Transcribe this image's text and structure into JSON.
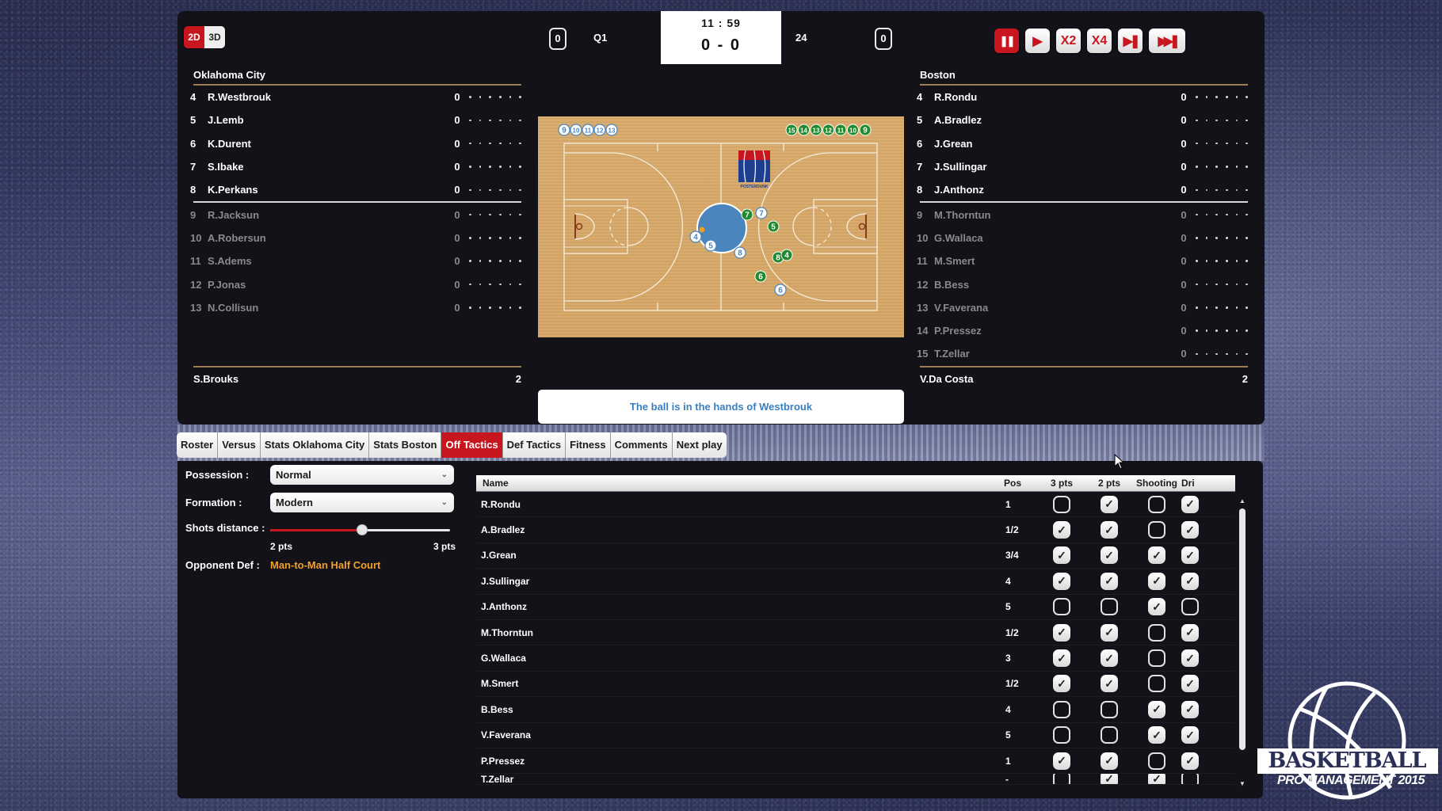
{
  "view_toggle": {
    "mode_2d": "2D",
    "mode_3d": "3D",
    "active": "2D"
  },
  "scoreboard": {
    "home_team_fouls": "0",
    "away_team_fouls": "0",
    "quarter": "Q1",
    "clock": "11 : 59",
    "score": "0 - 0",
    "shot_clock": "24"
  },
  "controls": [
    {
      "name": "pause",
      "label": "❚❚",
      "active": true
    },
    {
      "name": "play",
      "label": "▶",
      "active": false
    },
    {
      "name": "speed-x2",
      "label": "X2",
      "active": false
    },
    {
      "name": "speed-x4",
      "label": "X4",
      "active": false
    },
    {
      "name": "next-action",
      "label": "▶❚",
      "active": false
    },
    {
      "name": "skip-to-end",
      "label": "▶▶❚",
      "active": false
    }
  ],
  "home": {
    "team": "Oklahoma City",
    "starters": [
      {
        "num": "4",
        "name": "R.Westbrouk",
        "pts": "0"
      },
      {
        "num": "5",
        "name": "J.Lemb",
        "pts": "0"
      },
      {
        "num": "6",
        "name": "K.Durent",
        "pts": "0"
      },
      {
        "num": "7",
        "name": "S.Ibake",
        "pts": "0"
      },
      {
        "num": "8",
        "name": "K.Perkans",
        "pts": "0"
      }
    ],
    "bench": [
      {
        "num": "9",
        "name": "R.Jacksun",
        "pts": "0"
      },
      {
        "num": "10",
        "name": "A.Robersun",
        "pts": "0"
      },
      {
        "num": "11",
        "name": "S.Adems",
        "pts": "0"
      },
      {
        "num": "12",
        "name": "P.Jonas",
        "pts": "0"
      },
      {
        "num": "13",
        "name": "N.Collisun",
        "pts": "0"
      }
    ],
    "coach": {
      "name": "S.Brouks",
      "value": "2"
    }
  },
  "away": {
    "team": "Boston",
    "starters": [
      {
        "num": "4",
        "name": "R.Rondu",
        "pts": "0"
      },
      {
        "num": "5",
        "name": "A.Bradlez",
        "pts": "0"
      },
      {
        "num": "6",
        "name": "J.Grean",
        "pts": "0"
      },
      {
        "num": "7",
        "name": "J.Sullingar",
        "pts": "0"
      },
      {
        "num": "8",
        "name": "J.Anthonz",
        "pts": "0"
      }
    ],
    "bench": [
      {
        "num": "9",
        "name": "M.Thorntun",
        "pts": "0"
      },
      {
        "num": "10",
        "name": "G.Wallaca",
        "pts": "0"
      },
      {
        "num": "11",
        "name": "M.Smert",
        "pts": "0"
      },
      {
        "num": "12",
        "name": "B.Bess",
        "pts": "0"
      },
      {
        "num": "13",
        "name": "V.Faverana",
        "pts": "0"
      },
      {
        "num": "14",
        "name": "P.Pressez",
        "pts": "0"
      },
      {
        "num": "15",
        "name": "T.Zellar",
        "pts": "0"
      }
    ],
    "coach": {
      "name": "V.Da Costa",
      "value": "2"
    }
  },
  "court": {
    "home_bench_tokens": [
      "9",
      "10",
      "11",
      "12",
      "13"
    ],
    "away_bench_tokens": [
      "15",
      "14",
      "13",
      "12",
      "11",
      "10",
      "9"
    ],
    "sponsor_logo": "POSTERDUNK",
    "home_color": "#ffffff",
    "away_color": "#1f8a2e",
    "zone_color": "#4a86bd",
    "ball_color": "#f0a020",
    "home_players_on_court": [
      "4",
      "5",
      "8",
      "7",
      "6"
    ],
    "away_players_on_court": [
      "7",
      "5",
      "8",
      "4",
      "6"
    ],
    "ball_holder": "4"
  },
  "message": "The ball is in the hands of Westbrouk",
  "tabs": [
    {
      "label": "Roster",
      "active": false
    },
    {
      "label": "Versus",
      "active": false
    },
    {
      "label": "Stats Oklahoma City",
      "active": false
    },
    {
      "label": "Stats Boston",
      "active": false
    },
    {
      "label": "Off Tactics",
      "active": true
    },
    {
      "label": "Def Tactics",
      "active": false
    },
    {
      "label": "Fitness",
      "active": false
    },
    {
      "label": "Comments",
      "active": false
    },
    {
      "label": "Next play",
      "active": false
    }
  ],
  "tactics": {
    "possession_label": "Possession :",
    "possession_value": "Normal",
    "formation_label": "Formation :",
    "formation_value": "Modern",
    "shots_distance_label": "Shots distance :",
    "shots_distance_value": 0.51,
    "shots_min_label": "2 pts",
    "shots_max_label": "3 pts",
    "opponent_def_label": "Opponent Def :",
    "opponent_def_value": "Man-to-Man Half Court"
  },
  "table": {
    "columns": [
      "Name",
      "Pos",
      "3 pts",
      "2 pts",
      "Shooting",
      "Dri"
    ],
    "rows": [
      {
        "name": "R.Rondu",
        "pos": "1",
        "three": false,
        "two": true,
        "shooting": false,
        "dri": true
      },
      {
        "name": "A.Bradlez",
        "pos": "1/2",
        "three": true,
        "two": true,
        "shooting": false,
        "dri": true
      },
      {
        "name": "J.Grean",
        "pos": "3/4",
        "three": true,
        "two": true,
        "shooting": true,
        "dri": true
      },
      {
        "name": "J.Sullingar",
        "pos": "4",
        "three": true,
        "two": true,
        "shooting": true,
        "dri": true
      },
      {
        "name": "J.Anthonz",
        "pos": "5",
        "three": false,
        "two": false,
        "shooting": true,
        "dri": false
      },
      {
        "name": "M.Thorntun",
        "pos": "1/2",
        "three": true,
        "two": true,
        "shooting": false,
        "dri": true
      },
      {
        "name": "G.Wallaca",
        "pos": "3",
        "three": true,
        "two": true,
        "shooting": false,
        "dri": true
      },
      {
        "name": "M.Smert",
        "pos": "1/2",
        "three": true,
        "two": true,
        "shooting": false,
        "dri": true
      },
      {
        "name": "B.Bess",
        "pos": "4",
        "three": false,
        "two": false,
        "shooting": true,
        "dri": true
      },
      {
        "name": "V.Faverana",
        "pos": "5",
        "three": false,
        "two": false,
        "shooting": true,
        "dri": true
      },
      {
        "name": "P.Pressez",
        "pos": "1",
        "three": true,
        "two": true,
        "shooting": false,
        "dri": true
      },
      {
        "name": "T.Zellar",
        "pos": "-",
        "three": false,
        "two": true,
        "shooting": true,
        "dri": false
      }
    ]
  },
  "logo": {
    "title": "BASKETBALL",
    "subtitle": "PRO MANAGEMENT 2015"
  }
}
